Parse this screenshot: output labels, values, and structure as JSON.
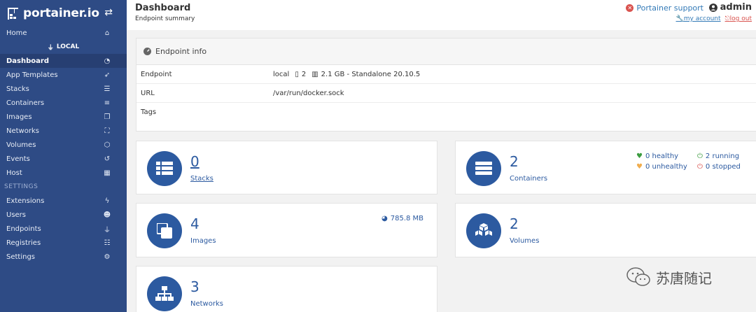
{
  "brand": {
    "name": "portainer.io"
  },
  "sidebar": {
    "home": "Home",
    "endpoint_label": "LOCAL",
    "items": [
      {
        "label": "Dashboard",
        "icon": "tachometer-icon",
        "active": true
      },
      {
        "label": "App Templates",
        "icon": "rocket-icon"
      },
      {
        "label": "Stacks",
        "icon": "th-list-icon"
      },
      {
        "label": "Containers",
        "icon": "server-icon"
      },
      {
        "label": "Images",
        "icon": "clone-icon"
      },
      {
        "label": "Networks",
        "icon": "sitemap-icon"
      },
      {
        "label": "Volumes",
        "icon": "cubes-icon"
      },
      {
        "label": "Events",
        "icon": "history-icon"
      },
      {
        "label": "Host",
        "icon": "th-icon"
      }
    ],
    "settings_header": "SETTINGS",
    "settings_items": [
      {
        "label": "Extensions",
        "icon": "bolt-icon"
      },
      {
        "label": "Users",
        "icon": "users-icon"
      },
      {
        "label": "Endpoints",
        "icon": "plug-icon"
      },
      {
        "label": "Registries",
        "icon": "database-icon"
      },
      {
        "label": "Settings",
        "icon": "cogs-icon"
      }
    ]
  },
  "header": {
    "title": "Dashboard",
    "subtitle": "Endpoint summary",
    "support": "Portainer support",
    "user": "admin",
    "my_account": "my account",
    "log_out": "log out"
  },
  "endpoint_info": {
    "title": "Endpoint info",
    "rows": {
      "endpoint_label": "Endpoint",
      "endpoint_name": "local",
      "cpu": "2",
      "memory_info": "2.1 GB - Standalone 20.10.5",
      "url_label": "URL",
      "url_value": "/var/run/docker.sock",
      "tags_label": "Tags"
    }
  },
  "tiles": {
    "stacks": {
      "count": "0",
      "label": "Stacks"
    },
    "containers": {
      "count": "2",
      "label": "Containers",
      "healthy": "0 healthy",
      "unhealthy": "0 unhealthy",
      "running": "2 running",
      "stopped": "0 stopped"
    },
    "images": {
      "count": "4",
      "label": "Images",
      "size": "785.8 MB"
    },
    "volumes": {
      "count": "2",
      "label": "Volumes"
    },
    "networks": {
      "count": "3",
      "label": "Networks"
    }
  },
  "colors": {
    "sidebar": "#2e4b85",
    "accent": "#2c5aa0",
    "danger": "#d9534f",
    "success": "#3c9c40",
    "warning": "#f0ad4e"
  },
  "watermark": {
    "text": "苏唐随记"
  }
}
